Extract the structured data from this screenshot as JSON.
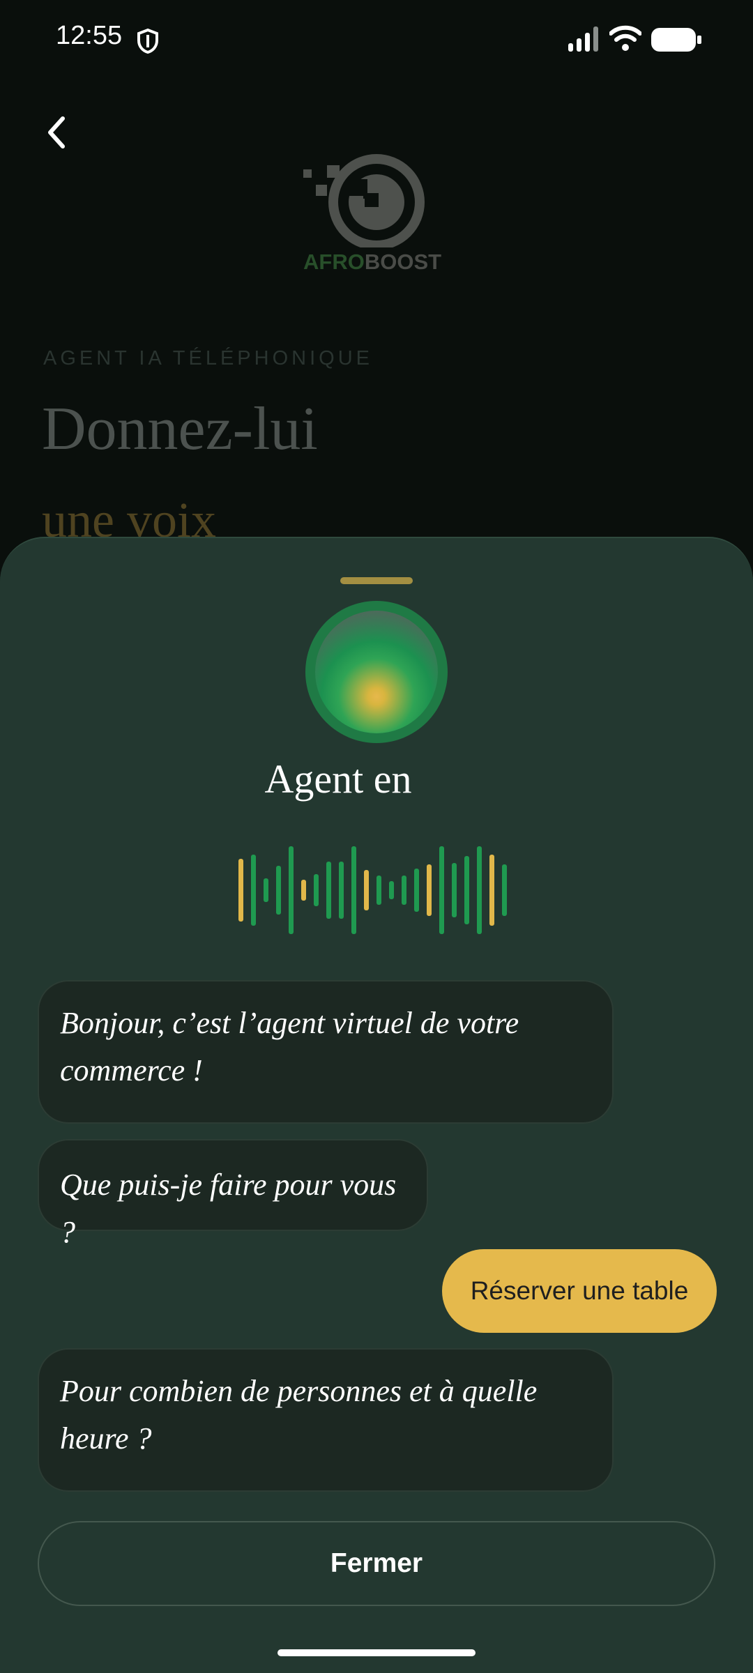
{
  "status_bar": {
    "time": "12:55",
    "icons": [
      "shield-icon",
      "signal-icon",
      "wifi-icon",
      "battery-icon"
    ]
  },
  "background_page": {
    "back_icon": "chevron-left-icon",
    "logo": {
      "word_part_1": "AFRO",
      "word_part_2": "BOOST"
    },
    "overline": "AGENT IA TÉLÉPHONIQUE",
    "headline_line_1": "Donnez-lui",
    "headline_line_2": "une voix"
  },
  "sheet": {
    "agent_title": "Agent en",
    "messages": [
      {
        "role": "agent",
        "text": "Bonjour, c’est l’agent virtuel de votre commerce !"
      },
      {
        "role": "agent",
        "text": "Que puis-je faire pour vous ?"
      },
      {
        "role": "user",
        "text": "Réserver une table"
      },
      {
        "role": "agent",
        "text": "Pour combien de personnes et à quelle heure ?"
      }
    ],
    "close_label": "Fermer"
  },
  "colors": {
    "accent_gold": "#e5b94c",
    "accent_green": "#1f9a50",
    "sheet_background": "#233830",
    "bubble_background": "#1c2822"
  }
}
